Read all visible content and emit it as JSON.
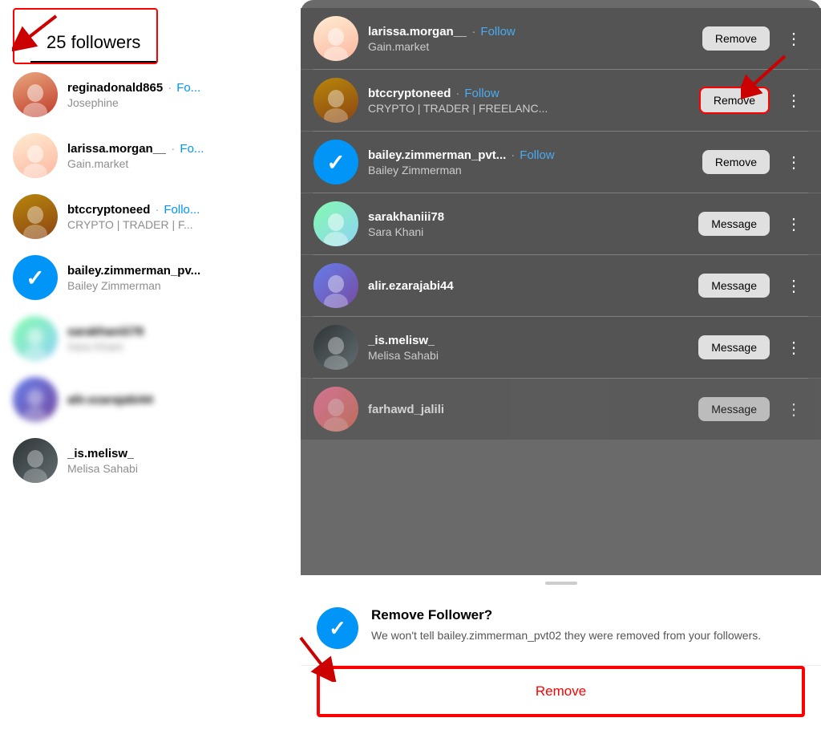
{
  "header": {
    "followers_count": "25 followers"
  },
  "left_followers": [
    {
      "username": "reginadonald865",
      "display_name": "Josephine",
      "follow_label": "Fo...",
      "has_follow": true,
      "avatar_class": "avatar-1",
      "blurred": false
    },
    {
      "username": "larissa.morgan__",
      "display_name": "Gain.market",
      "follow_label": "Fo...",
      "has_follow": true,
      "avatar_class": "avatar-2",
      "blurred": false
    },
    {
      "username": "btccryptoneed",
      "display_name": "CRYPTO | TRADER | F...",
      "follow_label": "Follo...",
      "has_follow": true,
      "avatar_class": "avatar-3",
      "blurred": false
    },
    {
      "username": "bailey.zimmerman_pv...",
      "display_name": "Bailey Zimmerman",
      "follow_label": "",
      "has_follow": false,
      "is_blue_check": true,
      "blurred": false
    },
    {
      "username": "sarakhaniii78",
      "display_name": "Sara Khani",
      "follow_label": "",
      "has_follow": false,
      "avatar_class": "avatar-4",
      "blurred": true
    },
    {
      "username": "alir.ezarajabi44",
      "display_name": "",
      "follow_label": "",
      "has_follow": false,
      "avatar_class": "avatar-5",
      "blurred": true
    },
    {
      "username": "_is.melisw_",
      "display_name": "Melisa Sahabi",
      "follow_label": "",
      "has_follow": false,
      "avatar_class": "avatar-6",
      "blurred": false
    }
  ],
  "right_followers": [
    {
      "username": "larissa.morgan__",
      "dot": "·",
      "follow_label": "Follow",
      "display_name": "Gain.market",
      "action": "Remove",
      "avatar_class": "avatar-2"
    },
    {
      "username": "btccryptoneed",
      "dot": "·",
      "follow_label": "Follow",
      "display_name": "CRYPTO | TRADER | FREELANC...",
      "action": "Remove",
      "action_highlighted": true,
      "avatar_class": "avatar-3"
    },
    {
      "username": "bailey.zimmerman_pvt...",
      "dot": "·",
      "follow_label": "Follow",
      "display_name": "Bailey Zimmerman",
      "action": "Remove",
      "is_blue_check": true
    },
    {
      "username": "sarakhaniii78",
      "dot": "",
      "follow_label": "",
      "display_name": "Sara Khani",
      "action": "Message",
      "avatar_class": "avatar-4"
    },
    {
      "username": "alir.ezarajabi44",
      "dot": "",
      "follow_label": "",
      "display_name": "",
      "action": "Message",
      "avatar_class": "avatar-5"
    },
    {
      "username": "_is.melisw_",
      "dot": "",
      "follow_label": "",
      "display_name": "Melisa Sahabi",
      "action": "Message",
      "avatar_class": "avatar-6"
    },
    {
      "username": "farhawd_jalili",
      "dot": "",
      "follow_label": "",
      "display_name": "",
      "action": "Message",
      "avatar_class": "avatar-7"
    }
  ],
  "bottom_sheet": {
    "title": "Remove Follower?",
    "description": "We won't tell bailey.zimmerman_pvt02 they were removed from your followers.",
    "remove_label": "Remove"
  },
  "arrows": {
    "top_left_label": "25 followers arrow",
    "mid_right_label": "Remove highlighted arrow",
    "bottom_label": "Remove follower bottom arrow"
  }
}
